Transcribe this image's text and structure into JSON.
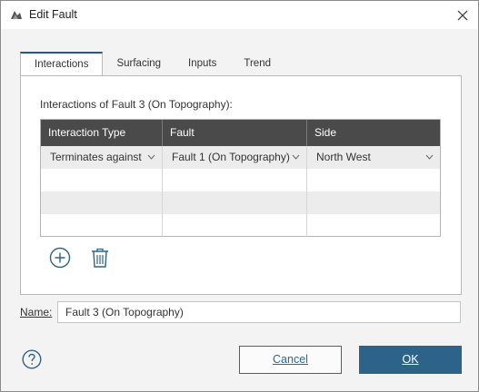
{
  "window": {
    "title": "Edit Fault",
    "close_icon": "close-icon",
    "app_icon": "app-logo-icon"
  },
  "tabs": [
    {
      "label": "Interactions",
      "active": true
    },
    {
      "label": "Surfacing",
      "active": false
    },
    {
      "label": "Inputs",
      "active": false
    },
    {
      "label": "Trend",
      "active": false
    }
  ],
  "interactions": {
    "section_label": "Interactions of Fault 3 (On Topography):",
    "columns": [
      "Interaction Type",
      "Fault",
      "Side"
    ],
    "rows": [
      {
        "type": "Terminates against",
        "fault": "Fault 1 (On Topography)",
        "side": "North West"
      }
    ],
    "add_icon": "add-circle-icon",
    "delete_icon": "trash-icon"
  },
  "name": {
    "label": "Name:",
    "value": "Fault 3 (On Topography)"
  },
  "footer": {
    "help_icon": "help-icon",
    "cancel_label": "Cancel",
    "ok_label": "OK"
  },
  "colors": {
    "accent": "#2d6388",
    "header_bg": "#4a4a4a",
    "tab_accent": "#1e5a8a"
  }
}
